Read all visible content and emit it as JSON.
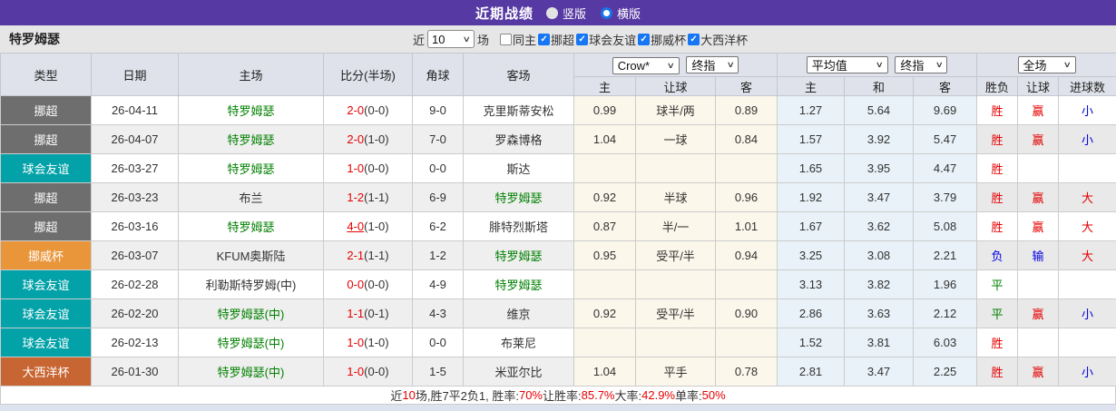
{
  "title_bar": {
    "title": "近期战绩",
    "radio_vertical": "竖版",
    "radio_horizontal": "横版",
    "bg_color": "#5639a3"
  },
  "filter_bar": {
    "team_name": "特罗姆瑟",
    "near_label": "近",
    "count_value": "10",
    "games_label": "场",
    "checkboxes": [
      {
        "label": "同主",
        "checked": false
      },
      {
        "label": "挪超",
        "checked": true
      },
      {
        "label": "球会友谊",
        "checked": true
      },
      {
        "label": "挪威杯",
        "checked": true
      },
      {
        "label": "大西洋杯",
        "checked": true
      }
    ]
  },
  "table": {
    "left_headers": [
      "类型",
      "日期",
      "主场",
      "比分(半场)",
      "角球",
      "客场"
    ],
    "selects": {
      "asian_company": "Crow*",
      "asian_time": "终指",
      "euro_company": "平均值",
      "euro_time": "终指",
      "scope": "全场"
    },
    "sub_headers": [
      "主",
      "让球",
      "客",
      "主",
      "和",
      "客",
      "胜负",
      "让球",
      "进球数"
    ],
    "type_styles": {
      "挪超": "#6e6e6e",
      "球会友谊": "#02a2a8",
      "挪威杯": "#e9963a",
      "大西洋杯": "#c76633"
    },
    "rows": [
      {
        "type": "挪超",
        "date": "26-04-11",
        "home": "特罗姆瑟",
        "home_hl": true,
        "score": "2-0",
        "half": "(0-0)",
        "underline": false,
        "corner": "9-0",
        "away": "克里斯蒂安松",
        "away_hl": false,
        "asian": [
          "0.99",
          "球半/两",
          "0.89"
        ],
        "euro": [
          "1.27",
          "5.64",
          "9.69"
        ],
        "outcome": {
          "t": "胜",
          "c": "r"
        },
        "let": {
          "t": "赢",
          "c": "r"
        },
        "goal": {
          "t": "小",
          "c": "b"
        }
      },
      {
        "type": "挪超",
        "date": "26-04-07",
        "home": "特罗姆瑟",
        "home_hl": true,
        "score": "2-0",
        "half": "(1-0)",
        "underline": false,
        "corner": "7-0",
        "away": "罗森博格",
        "away_hl": false,
        "asian": [
          "1.04",
          "一球",
          "0.84"
        ],
        "euro": [
          "1.57",
          "3.92",
          "5.47"
        ],
        "outcome": {
          "t": "胜",
          "c": "r"
        },
        "let": {
          "t": "赢",
          "c": "r"
        },
        "goal": {
          "t": "小",
          "c": "b"
        }
      },
      {
        "type": "球会友谊",
        "date": "26-03-27",
        "home": "特罗姆瑟",
        "home_hl": true,
        "score": "1-0",
        "half": "(0-0)",
        "underline": false,
        "corner": "0-0",
        "away": "斯达",
        "away_hl": false,
        "asian": [
          "",
          "",
          ""
        ],
        "euro": [
          "1.65",
          "3.95",
          "4.47"
        ],
        "outcome": {
          "t": "胜",
          "c": "r"
        },
        "let": {
          "t": "",
          "c": "r"
        },
        "goal": {
          "t": "",
          "c": "r"
        }
      },
      {
        "type": "挪超",
        "date": "26-03-23",
        "home": "布兰",
        "home_hl": false,
        "score": "1-2",
        "half": "(1-1)",
        "underline": false,
        "corner": "6-9",
        "away": "特罗姆瑟",
        "away_hl": true,
        "asian": [
          "0.92",
          "半球",
          "0.96"
        ],
        "euro": [
          "1.92",
          "3.47",
          "3.79"
        ],
        "outcome": {
          "t": "胜",
          "c": "r"
        },
        "let": {
          "t": "赢",
          "c": "r"
        },
        "goal": {
          "t": "大",
          "c": "r"
        }
      },
      {
        "type": "挪超",
        "date": "26-03-16",
        "home": "特罗姆瑟",
        "home_hl": true,
        "score": "4-0",
        "half": "(1-0)",
        "underline": true,
        "corner": "6-2",
        "away": "腓特烈斯塔",
        "away_hl": false,
        "asian": [
          "0.87",
          "半/一",
          "1.01"
        ],
        "euro": [
          "1.67",
          "3.62",
          "5.08"
        ],
        "outcome": {
          "t": "胜",
          "c": "r"
        },
        "let": {
          "t": "赢",
          "c": "r"
        },
        "goal": {
          "t": "大",
          "c": "r"
        }
      },
      {
        "type": "挪威杯",
        "date": "26-03-07",
        "home": "KFUM奥斯陆",
        "home_hl": false,
        "score": "2-1",
        "half": "(1-1)",
        "underline": false,
        "corner": "1-2",
        "away": "特罗姆瑟",
        "away_hl": true,
        "asian": [
          "0.95",
          "受平/半",
          "0.94"
        ],
        "euro": [
          "3.25",
          "3.08",
          "2.21"
        ],
        "outcome": {
          "t": "负",
          "c": "b"
        },
        "let": {
          "t": "输",
          "c": "b"
        },
        "goal": {
          "t": "大",
          "c": "r"
        }
      },
      {
        "type": "球会友谊",
        "date": "26-02-28",
        "home": "利勒斯特罗姆(中)",
        "home_hl": false,
        "score": "0-0",
        "half": "(0-0)",
        "underline": false,
        "corner": "4-9",
        "away": "特罗姆瑟",
        "away_hl": true,
        "asian": [
          "",
          "",
          ""
        ],
        "euro": [
          "3.13",
          "3.82",
          "1.96"
        ],
        "outcome": {
          "t": "平",
          "c": "g"
        },
        "let": {
          "t": "",
          "c": "r"
        },
        "goal": {
          "t": "",
          "c": "r"
        }
      },
      {
        "type": "球会友谊",
        "date": "26-02-20",
        "home": "特罗姆瑟(中)",
        "home_hl": true,
        "score": "1-1",
        "half": "(0-1)",
        "underline": false,
        "corner": "4-3",
        "away": "维京",
        "away_hl": false,
        "asian": [
          "0.92",
          "受平/半",
          "0.90"
        ],
        "euro": [
          "2.86",
          "3.63",
          "2.12"
        ],
        "outcome": {
          "t": "平",
          "c": "g"
        },
        "let": {
          "t": "赢",
          "c": "r"
        },
        "goal": {
          "t": "小",
          "c": "b"
        }
      },
      {
        "type": "球会友谊",
        "date": "26-02-13",
        "home": "特罗姆瑟(中)",
        "home_hl": true,
        "score": "1-0",
        "half": "(1-0)",
        "underline": false,
        "corner": "0-0",
        "away": "布莱尼",
        "away_hl": false,
        "asian": [
          "",
          "",
          ""
        ],
        "euro": [
          "1.52",
          "3.81",
          "6.03"
        ],
        "outcome": {
          "t": "胜",
          "c": "r"
        },
        "let": {
          "t": "",
          "c": "r"
        },
        "goal": {
          "t": "",
          "c": "r"
        }
      },
      {
        "type": "大西洋杯",
        "date": "26-01-30",
        "home": "特罗姆瑟(中)",
        "home_hl": true,
        "score": "1-0",
        "half": "(0-0)",
        "underline": false,
        "corner": "1-5",
        "away": "米亚尔比",
        "away_hl": false,
        "asian": [
          "1.04",
          "平手",
          "0.78"
        ],
        "euro": [
          "2.81",
          "3.47",
          "2.25"
        ],
        "outcome": {
          "t": "胜",
          "c": "r"
        },
        "let": {
          "t": "赢",
          "c": "r"
        },
        "goal": {
          "t": "小",
          "c": "b"
        }
      }
    ],
    "summary_segments": [
      {
        "t": "近",
        "c": "k"
      },
      {
        "t": "10",
        "c": "r"
      },
      {
        "t": "场,胜7平2负1, 胜率:",
        "c": "k"
      },
      {
        "t": "70%",
        "c": "r"
      },
      {
        "t": " 让胜率:",
        "c": "k"
      },
      {
        "t": "85.7%",
        "c": "r"
      },
      {
        "t": " 大率:",
        "c": "k"
      },
      {
        "t": "42.9%",
        "c": "r"
      },
      {
        "t": " 单率:",
        "c": "k"
      },
      {
        "t": "50%",
        "c": "r"
      }
    ]
  }
}
